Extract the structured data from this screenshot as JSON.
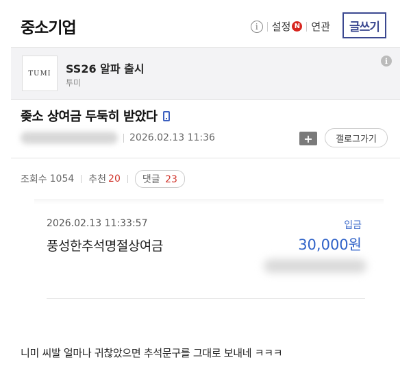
{
  "header": {
    "gallery_title": "중소기업",
    "info_icon": "i",
    "settings_label": "설정",
    "settings_badge": "N",
    "related_label": "연관",
    "write_button": "글쓰기"
  },
  "ad": {
    "logo_text": "TUMI",
    "title": "SS26 알파 출시",
    "subtitle": "투미",
    "info_icon": "i"
  },
  "post": {
    "title": "좆소 상여금 두둑히 받았다",
    "date": "2026.02.13 11:36",
    "folder_icon": "+",
    "gallery_button": "갤로그가기"
  },
  "stats": {
    "views_label": "조회수",
    "views": "1054",
    "recommend_label": "추천",
    "recommend": "20",
    "comments_label": "댓글",
    "comments": "23"
  },
  "transaction": {
    "datetime": "2026.02.13  11:33:57",
    "type": "입금",
    "description": "풍성한추석명절상여금",
    "amount": "30,000원"
  },
  "body_text": "니미 씨발 얼마나 귀찮았으면 추석문구를 그대로 보내네 ㅋㅋㅋ",
  "colors": {
    "accent": "#3b4890",
    "link_blue": "#2f62c8",
    "badge_red": "#d7261f",
    "highlight_red": "#d0332a"
  }
}
